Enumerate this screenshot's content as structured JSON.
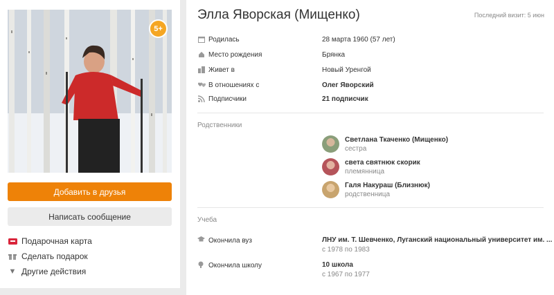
{
  "profile": {
    "age_badge": "5+",
    "add_friend_label": "Добавить в друзья",
    "message_label": "Написать сообщение",
    "actions": [
      {
        "label": "Подарочная карта",
        "icon": "gift-card-icon"
      },
      {
        "label": "Сделать подарок",
        "icon": "gift-icon"
      },
      {
        "label": "Другие действия",
        "icon": "triangle-down-icon"
      }
    ]
  },
  "header": {
    "name": "Элла Яворская (Мищенко)",
    "last_visit": "Последний визит: 5 июн"
  },
  "info": [
    {
      "label": "Родилась",
      "value": "28 марта 1960 (57 лет)",
      "icon": "calendar-icon",
      "bold": false
    },
    {
      "label": "Место рождения",
      "value": "Брянка",
      "icon": "home-icon",
      "bold": false
    },
    {
      "label": "Живет в",
      "value": "Новый Уренгой",
      "icon": "city-icon",
      "bold": false
    },
    {
      "label": "В отношениях с",
      "value": "Олег Яворский",
      "icon": "hearts-icon",
      "bold": true
    },
    {
      "label": "Подписчики",
      "value": "21 подписчик",
      "icon": "signal-icon",
      "bold": true
    }
  ],
  "relatives": {
    "title": "Родственники",
    "items": [
      {
        "name": "Светлана Ткаченко (Мищенко)",
        "role": "сестра",
        "color": "#8a9e7a"
      },
      {
        "name": "света святнюк скорик",
        "role": "племянница",
        "color": "#b5545a"
      },
      {
        "name": "Галя Накураш (Близнюк)",
        "role": "родственница",
        "color": "#c8a46e"
      }
    ]
  },
  "education": {
    "title": "Учеба",
    "items": [
      {
        "label": "Окончила вуз",
        "icon": "graduation-cap-icon",
        "title": "ЛНУ им. Т. Шевченко, Луганский национальный университет им. ...",
        "years": "с 1978 по 1983"
      },
      {
        "label": "Окончила школу",
        "icon": "school-bell-icon",
        "title": "10 школа",
        "years": "с 1967 по 1977"
      }
    ]
  },
  "colors": {
    "accent": "#ee8208",
    "badge": "#f5a623"
  }
}
